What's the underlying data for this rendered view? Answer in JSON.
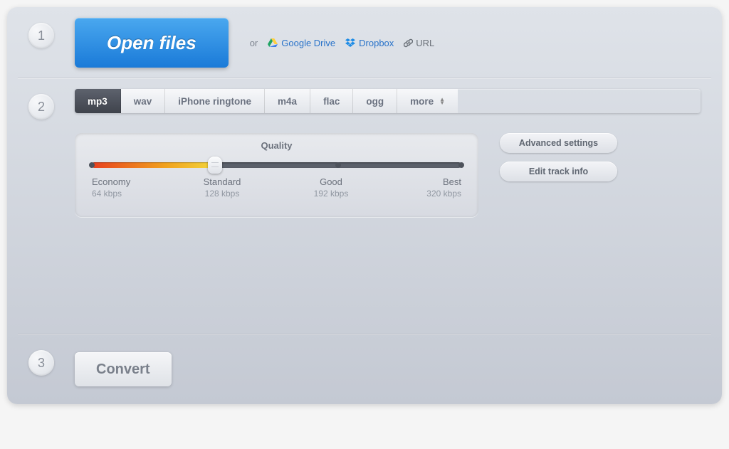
{
  "steps": {
    "one": "1",
    "two": "2",
    "three": "3"
  },
  "open": {
    "button": "Open files",
    "or": "or"
  },
  "cloud": {
    "gdrive": "Google Drive",
    "dropbox": "Dropbox",
    "url": "URL"
  },
  "formats": [
    "mp3",
    "wav",
    "iPhone ringtone",
    "m4a",
    "flac",
    "ogg",
    "more"
  ],
  "quality": {
    "title": "Quality",
    "marks": [
      {
        "label": "Economy",
        "sub": "64 kbps"
      },
      {
        "label": "Standard",
        "sub": "128 kbps"
      },
      {
        "label": "Good",
        "sub": "192 kbps"
      },
      {
        "label": "Best",
        "sub": "320 kbps"
      }
    ],
    "selected_index": 1
  },
  "buttons": {
    "advanced": "Advanced settings",
    "edit_track": "Edit track info",
    "convert": "Convert"
  },
  "colors": {
    "primary_blue_top": "#4aa8ef",
    "primary_blue_bottom": "#1a7ad8",
    "link": "#2872c9",
    "tab_active_bg": "#3f434c",
    "slider_fill_start": "#e8401f",
    "slider_fill_end": "#f3d63c"
  }
}
